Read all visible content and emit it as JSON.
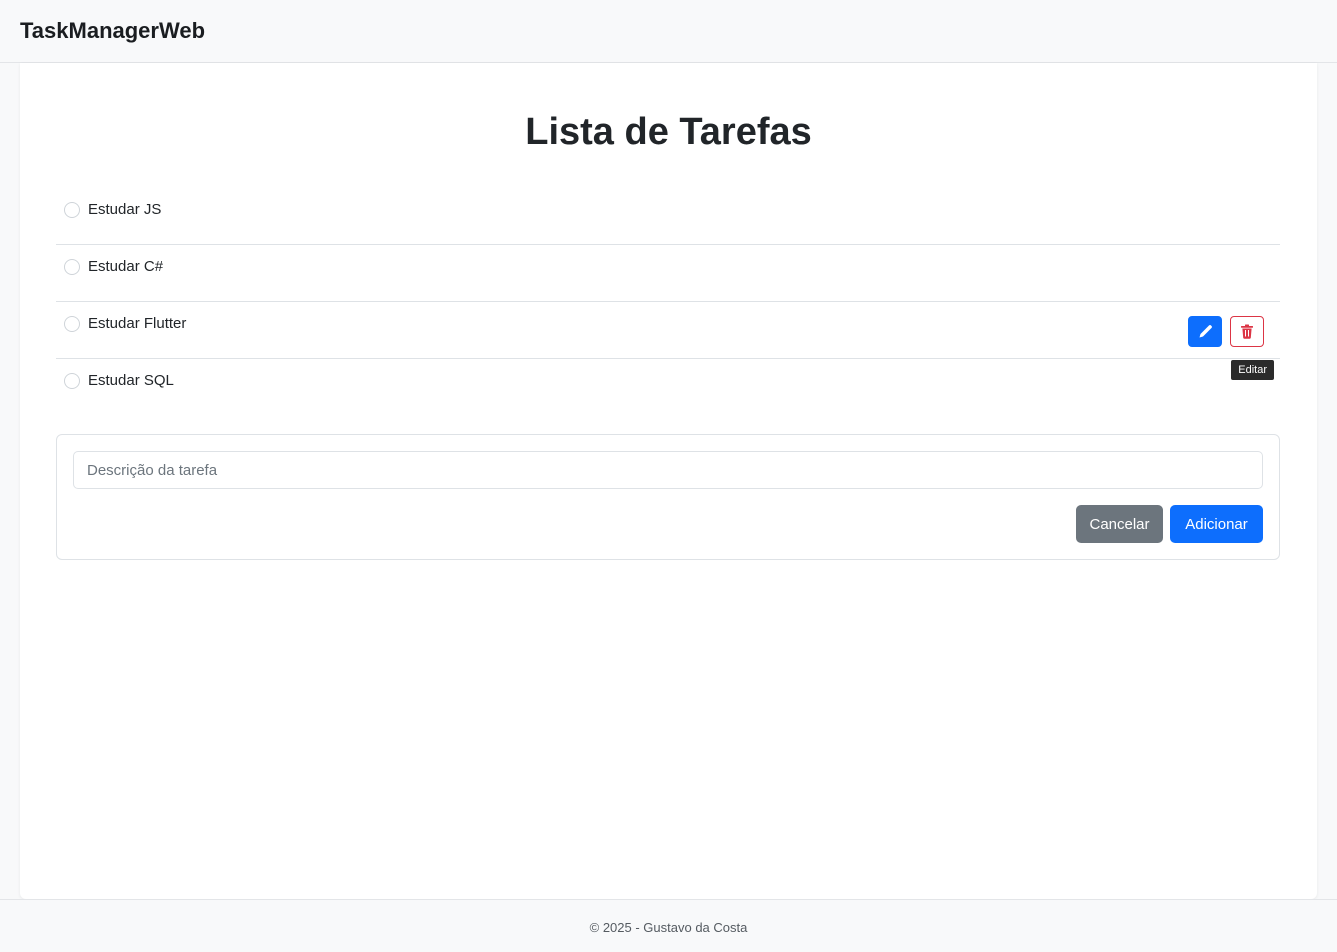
{
  "navbar": {
    "brand": "TaskManagerWeb"
  },
  "main": {
    "title": "Lista de Tarefas",
    "tasks": [
      {
        "label": "Estudar JS"
      },
      {
        "label": "Estudar C#"
      },
      {
        "label": "Estudar Flutter"
      },
      {
        "label": "Estudar SQL"
      }
    ],
    "actions": {
      "edit_icon": "pencil-icon",
      "delete_icon": "trash-icon",
      "tooltip": "Editar"
    }
  },
  "form": {
    "input_placeholder": "Descrição da tarefa",
    "input_value": "",
    "cancel_label": "Cancelar",
    "add_label": "Adicionar"
  },
  "footer": {
    "text": "© 2025 - Gustavo da Costa"
  },
  "colors": {
    "primary": "#0d6efd",
    "secondary": "#6c757d",
    "danger": "#dc3545",
    "navbar_bg": "#f8f9fa"
  }
}
